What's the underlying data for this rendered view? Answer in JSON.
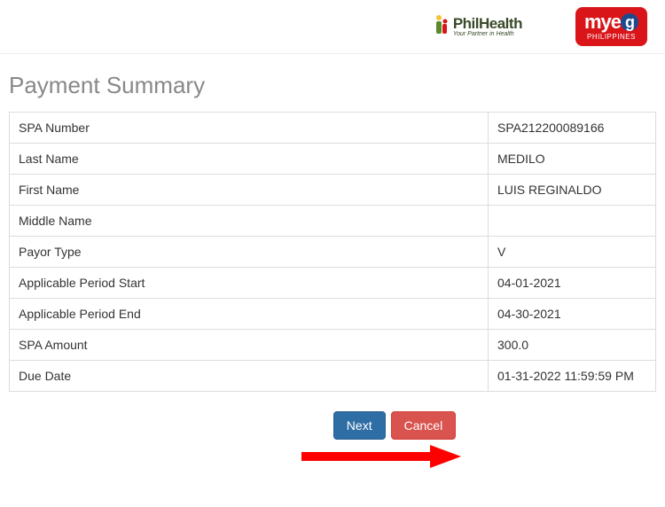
{
  "header": {
    "philhealth": {
      "name": "PhilHealth",
      "tagline": "Your Partner in Health"
    },
    "myeg": {
      "brand_pre": "mye",
      "brand_g": "g",
      "sub": "PHILIPPINES"
    }
  },
  "title": "Payment Summary",
  "summary": [
    {
      "label": "SPA Number",
      "value": "SPA212200089166"
    },
    {
      "label": "Last Name",
      "value": "MEDILO"
    },
    {
      "label": "First Name",
      "value": "LUIS REGINALDO"
    },
    {
      "label": "Middle Name",
      "value": ""
    },
    {
      "label": "Payor Type",
      "value": "V"
    },
    {
      "label": "Applicable Period Start",
      "value": "04-01-2021"
    },
    {
      "label": "Applicable Period End",
      "value": "04-30-2021"
    },
    {
      "label": "SPA Amount",
      "value": "300.0"
    },
    {
      "label": "Due Date",
      "value": "01-31-2022 11:59:59 PM"
    }
  ],
  "buttons": {
    "next": "Next",
    "cancel": "Cancel"
  }
}
